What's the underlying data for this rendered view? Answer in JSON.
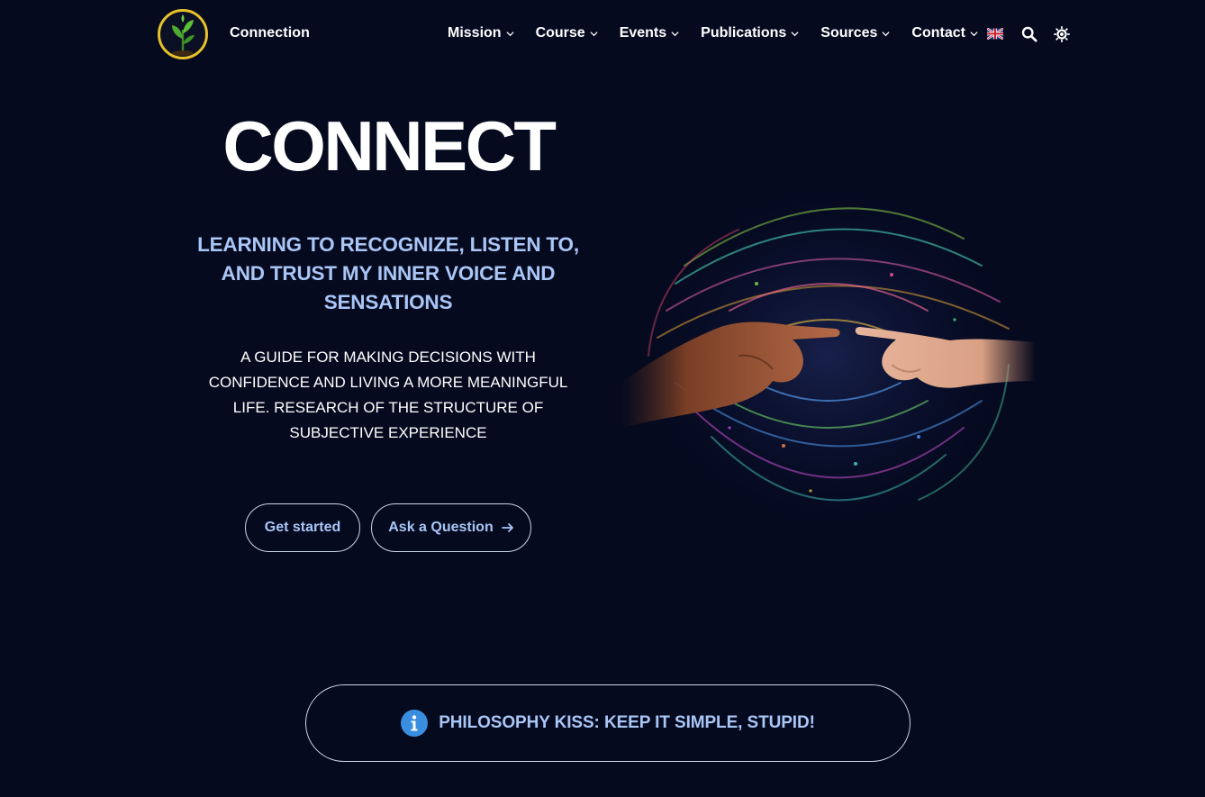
{
  "header": {
    "brand": "Connection",
    "nav": [
      {
        "label": "Mission"
      },
      {
        "label": "Course"
      },
      {
        "label": "Events"
      },
      {
        "label": "Publications"
      },
      {
        "label": "Sources"
      },
      {
        "label": "Contact"
      }
    ],
    "icons": {
      "language": "uk-flag-icon",
      "search": "search-icon",
      "theme": "sun-icon"
    }
  },
  "hero": {
    "title": "CONNECT",
    "subtitle": "LEARNING TO RECOGNIZE, LISTEN TO, AND TRUST MY INNER VOICE AND SENSATIONS",
    "description": "A GUIDE FOR MAKING DECISIONS WITH CONFIDENCE AND LIVING A MORE MEANINGFUL LIFE. RESEARCH OF THE STRUCTURE OF SUBJECTIVE EXPERIENCE",
    "buttons": {
      "primary": "Get started",
      "secondary": "Ask a Question"
    }
  },
  "callout": {
    "icon": "info-icon",
    "text": "PHILOSOPHY KISS: KEEP IT SIMPLE, STUPID!"
  },
  "colors": {
    "background": "#060a1f",
    "accent": "#a9c6f6",
    "logo_ring": "#e8c22a",
    "info_blue": "#3a8ee0"
  }
}
